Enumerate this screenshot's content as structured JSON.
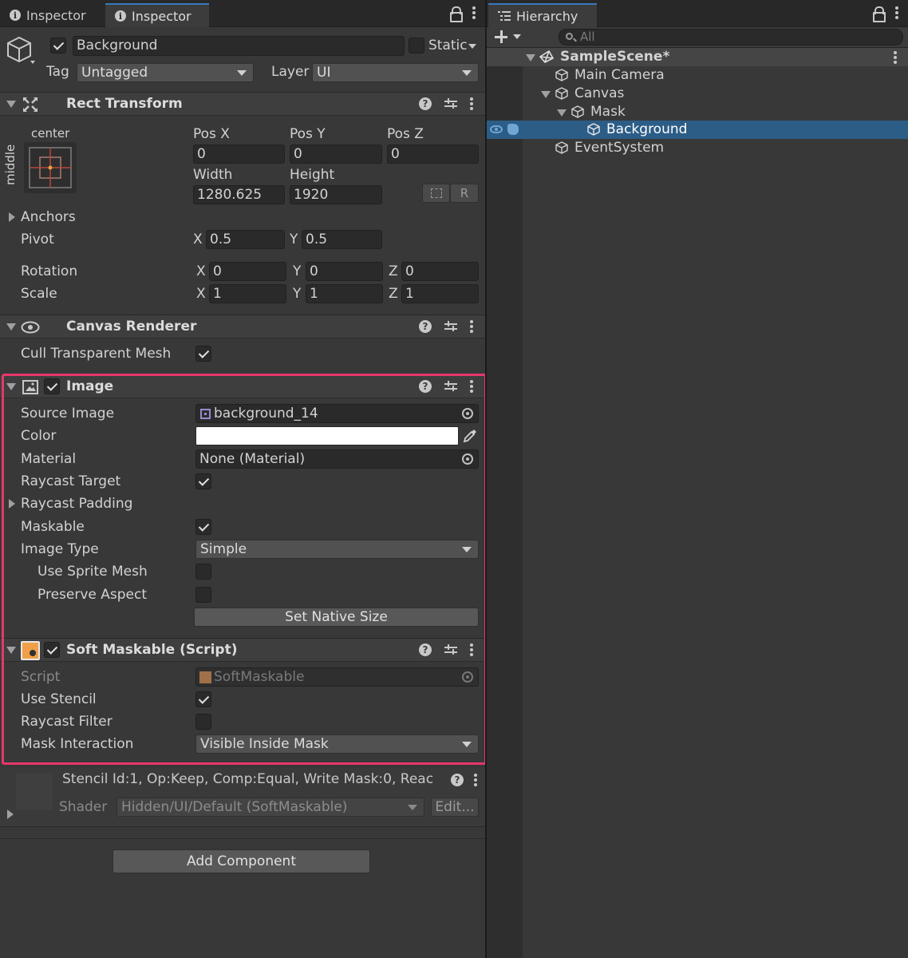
{
  "inspector": {
    "tabs": [
      {
        "label": "Inspector",
        "active": false
      },
      {
        "label": "Inspector",
        "active": true
      }
    ],
    "object": {
      "name": "Background",
      "active": true,
      "static_label": "Static",
      "tag_label": "Tag",
      "tag_value": "Untagged",
      "layer_label": "Layer",
      "layer_value": "UI"
    },
    "rect_transform": {
      "title": "Rect Transform",
      "anchor_h": "center",
      "anchor_v": "middle",
      "pos_x_label": "Pos X",
      "pos_x": "0",
      "pos_y_label": "Pos Y",
      "pos_y": "0",
      "pos_z_label": "Pos Z",
      "pos_z": "0",
      "width_label": "Width",
      "width": "1280.625",
      "height_label": "Height",
      "height": "1920",
      "raw_button": "R",
      "anchors_label": "Anchors",
      "pivot_label": "Pivot",
      "pivot_x": "0.5",
      "pivot_y": "0.5",
      "rotation_label": "Rotation",
      "rot_x": "0",
      "rot_y": "0",
      "rot_z": "0",
      "scale_label": "Scale",
      "scale_x": "1",
      "scale_y": "1",
      "scale_z": "1",
      "axis_x": "X",
      "axis_y": "Y",
      "axis_z": "Z"
    },
    "canvas_renderer": {
      "title": "Canvas Renderer",
      "cull_label": "Cull Transparent Mesh",
      "cull_value": true
    },
    "image": {
      "title": "Image",
      "enabled": true,
      "source_image_label": "Source Image",
      "source_image_value": "background_14",
      "color_label": "Color",
      "color_value": "#FFFFFF",
      "material_label": "Material",
      "material_value": "None (Material)",
      "raycast_target_label": "Raycast Target",
      "raycast_target": true,
      "raycast_padding_label": "Raycast Padding",
      "maskable_label": "Maskable",
      "maskable": true,
      "image_type_label": "Image Type",
      "image_type_value": "Simple",
      "use_sprite_mesh_label": "Use Sprite Mesh",
      "use_sprite_mesh": false,
      "preserve_aspect_label": "Preserve Aspect",
      "preserve_aspect": false,
      "set_native_size": "Set Native Size"
    },
    "soft_maskable": {
      "title": "Soft Maskable (Script)",
      "enabled": true,
      "script_label": "Script",
      "script_value": "SoftMaskable",
      "use_stencil_label": "Use Stencil",
      "use_stencil": true,
      "raycast_filter_label": "Raycast Filter",
      "raycast_filter": false,
      "mask_interaction_label": "Mask Interaction",
      "mask_interaction_value": "Visible Inside Mask"
    },
    "material_preview": {
      "stencil_text": "Stencil Id:1, Op:Keep, Comp:Equal, Write Mask:0, Reac",
      "shader_label": "Shader",
      "shader_value": "Hidden/UI/Default (SoftMaskable)",
      "edit_button": "Edit..."
    },
    "add_component": "Add Component"
  },
  "hierarchy": {
    "tab_label": "Hierarchy",
    "search_placeholder": "All",
    "scene_name": "SampleScene*",
    "items": [
      {
        "label": "Main Camera",
        "depth": 1,
        "expanded": null,
        "selected": false
      },
      {
        "label": "Canvas",
        "depth": 1,
        "expanded": true,
        "selected": false
      },
      {
        "label": "Mask",
        "depth": 2,
        "expanded": true,
        "selected": false
      },
      {
        "label": "Background",
        "depth": 3,
        "expanded": null,
        "selected": true
      },
      {
        "label": "EventSystem",
        "depth": 1,
        "expanded": null,
        "selected": false
      }
    ]
  },
  "colors": {
    "highlight": "#E8376B",
    "selection": "#2C5D87",
    "panel_bg": "#383838",
    "field_bg": "#2A2A2A"
  }
}
